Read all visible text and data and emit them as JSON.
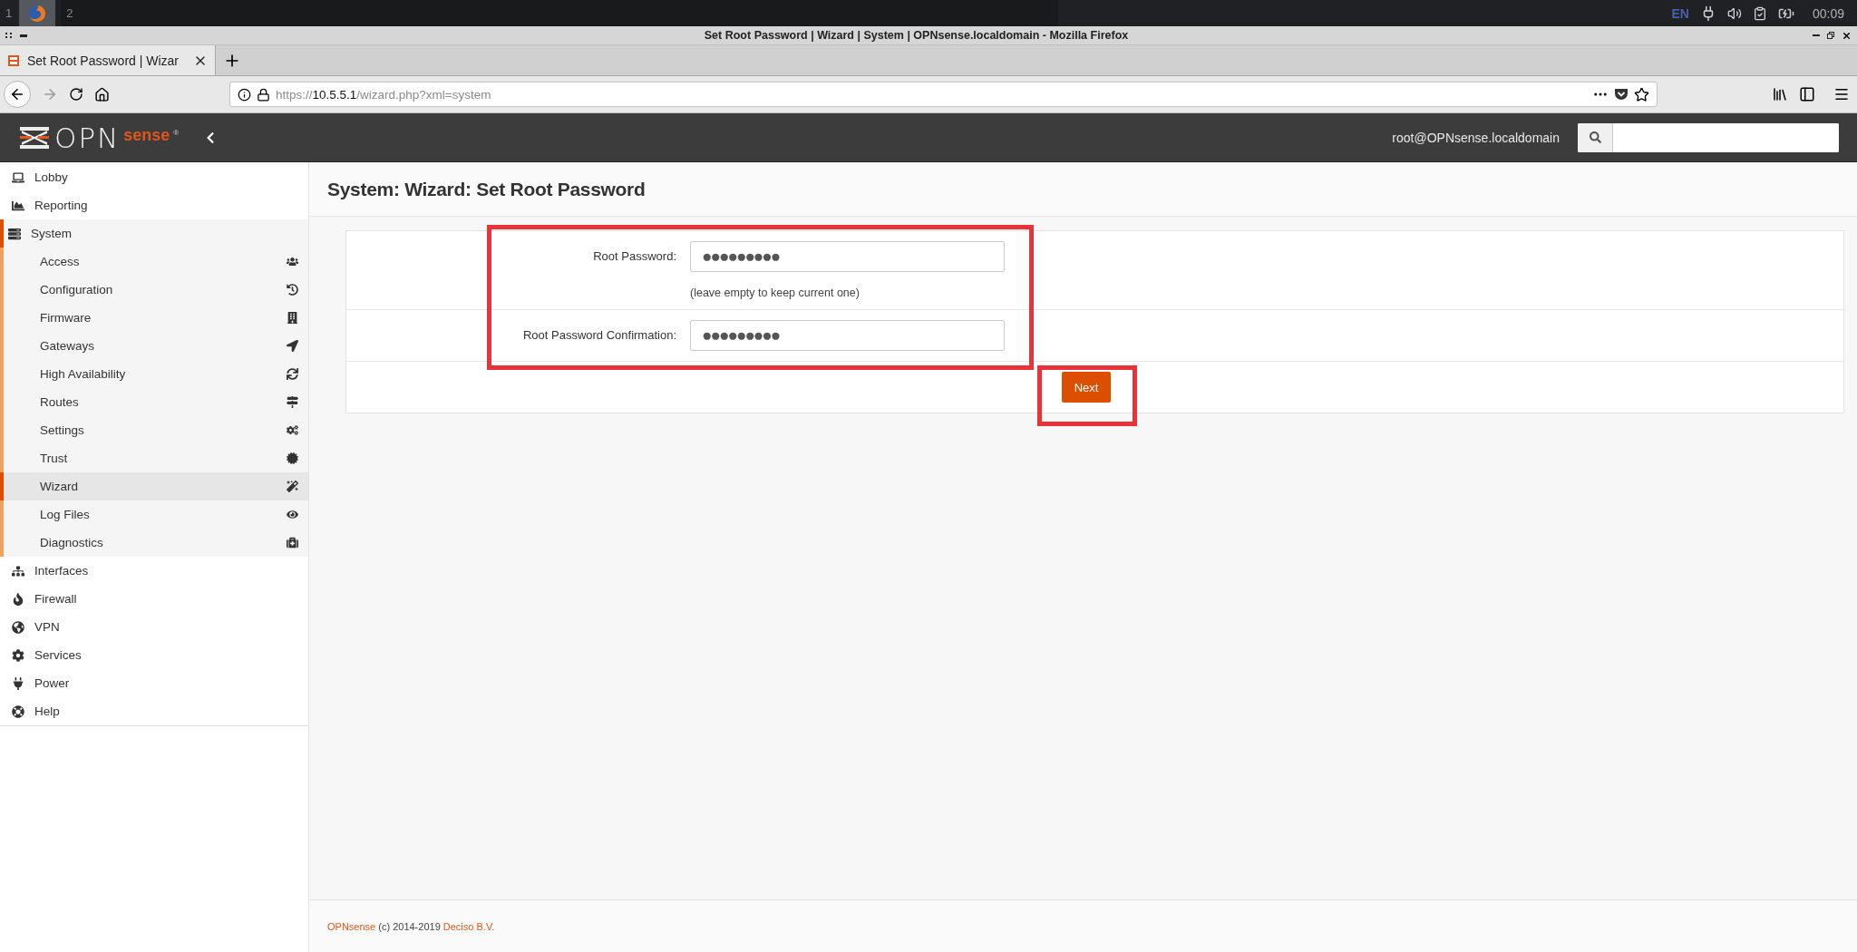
{
  "taskbar": {
    "workspaces": [
      {
        "label": "1",
        "selected": true
      },
      {
        "label": "2",
        "selected": false
      }
    ],
    "keyboard_layout": "EN",
    "clock": "00:09"
  },
  "window": {
    "title": "Set Root Password | Wizard | System | OPNsense.localdomain - Mozilla Firefox"
  },
  "browser": {
    "tabs": [
      {
        "label": "Set Root Password | Wizar",
        "selected": true
      }
    ],
    "url": {
      "scheme": "https://",
      "host": "10.5.5.1",
      "path": "/wizard.php?xml=system"
    }
  },
  "header": {
    "logo": {
      "main": "OPN",
      "accent": "sense",
      "mark": "®"
    },
    "user": "root@OPNsense.localdomain"
  },
  "sidebar": {
    "items": [
      {
        "label": "Lobby",
        "expanded": false
      },
      {
        "label": "Reporting",
        "expanded": false
      },
      {
        "label": "System",
        "expanded": true,
        "children": [
          {
            "label": "Access",
            "selected": false
          },
          {
            "label": "Configuration",
            "selected": false
          },
          {
            "label": "Firmware",
            "selected": false
          },
          {
            "label": "Gateways",
            "selected": false
          },
          {
            "label": "High Availability",
            "selected": false
          },
          {
            "label": "Routes",
            "selected": false
          },
          {
            "label": "Settings",
            "selected": false
          },
          {
            "label": "Trust",
            "selected": false
          },
          {
            "label": "Wizard",
            "selected": true
          },
          {
            "label": "Log Files",
            "selected": false
          },
          {
            "label": "Diagnostics",
            "selected": false
          }
        ]
      },
      {
        "label": "Interfaces",
        "expanded": false
      },
      {
        "label": "Firewall",
        "expanded": false
      },
      {
        "label": "VPN",
        "expanded": false
      },
      {
        "label": "Services",
        "expanded": false
      },
      {
        "label": "Power",
        "expanded": false
      },
      {
        "label": "Help",
        "expanded": false
      }
    ]
  },
  "page": {
    "title": "System: Wizard: Set Root Password",
    "fields": [
      {
        "label": "Root Password:",
        "value": "●●●●●●●●●",
        "hint": "(leave empty to keep current one)"
      },
      {
        "label": "Root Password Confirmation:",
        "value": "●●●●●●●●●"
      }
    ],
    "button": "Next"
  },
  "footer": {
    "parts": [
      {
        "text": "OPNsense",
        "kind": "link"
      },
      {
        "text": " (c) 2014-2019 ",
        "kind": "text"
      },
      {
        "text": "Deciso B.V.",
        "kind": "link"
      }
    ]
  }
}
